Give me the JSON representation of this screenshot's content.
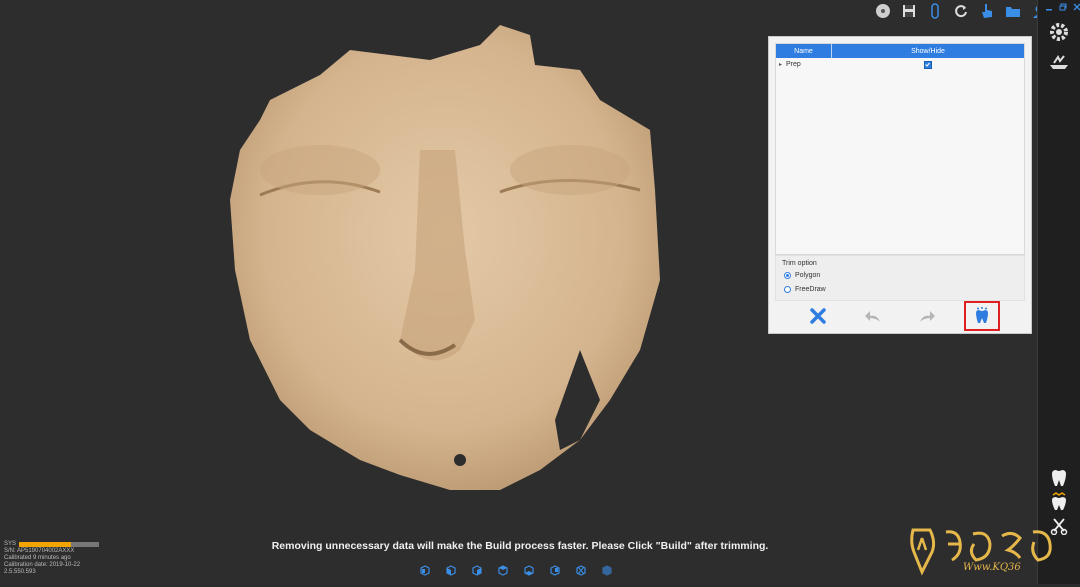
{
  "table": {
    "headers": [
      "Name",
      "Show/Hide"
    ],
    "rows": [
      {
        "name": "Prep",
        "visible": true
      }
    ]
  },
  "trim": {
    "title": "Trim option",
    "options": [
      "Polygon",
      "FreeDraw"
    ],
    "selected": "Polygon"
  },
  "status": {
    "sys_label": "SYS",
    "sys_level": 0.65,
    "serial": "S/N: AP5190704002AXXX",
    "calibrated": "Calibrated 9 minutes ago",
    "calibration_date": "Calibration date: 2019-10-22",
    "version": "2.5.550.593"
  },
  "message": "Removing unnecessary data will make the Build process faster. Please Click \"Build\" after trimming.",
  "watermark": "Www.KQ36",
  "colors": {
    "accent": "#2f7de1",
    "face": "#d9bc98",
    "highlight": "#e02020",
    "sys": "#f2a500"
  },
  "icons": {
    "top_toolbar": [
      "disc-icon",
      "save-icon",
      "probe-icon",
      "refresh-icon",
      "hand-pointer-icon",
      "folder-open-icon",
      "user-icon"
    ],
    "right_sidebar": [
      "settings-gear-icon",
      "scan-tray-icon",
      "tooth-icon",
      "tooth-crown-icon",
      "scissors-icon"
    ],
    "view_bar": [
      "view-front-icon",
      "view-left-icon",
      "view-right-icon",
      "view-top-icon",
      "view-bottom-icon",
      "view-back-icon",
      "view-fit-icon",
      "view-iso-icon"
    ]
  }
}
